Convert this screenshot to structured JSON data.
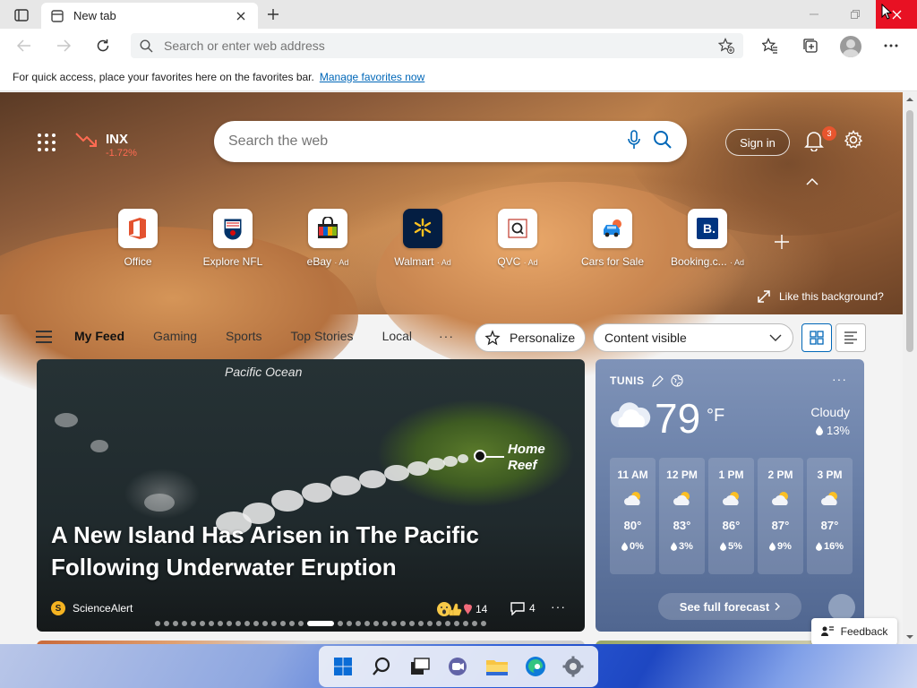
{
  "browser": {
    "tab_title": "New tab",
    "address_placeholder": "Search or enter web address",
    "favorites_message": "For quick access, place your favorites here on the favorites bar.",
    "favorites_link": "Manage favorites now"
  },
  "hero": {
    "stock_symbol": "INX",
    "stock_change": "-1.72%",
    "search_placeholder": "Search the web",
    "sign_in_label": "Sign in",
    "notification_count": "3",
    "like_background_label": "Like this background?",
    "tiles": [
      {
        "label": "Office",
        "ad": ""
      },
      {
        "label": "Explore NFL",
        "ad": ""
      },
      {
        "label": "eBay",
        "ad": "· Ad"
      },
      {
        "label": "Walmart",
        "ad": "· Ad"
      },
      {
        "label": "QVC",
        "ad": "· Ad"
      },
      {
        "label": "Cars for Sale",
        "ad": ""
      },
      {
        "label": "Booking.c...",
        "ad": "· Ad"
      }
    ]
  },
  "feed_nav": {
    "tabs": [
      "My Feed",
      "Gaming",
      "Sports",
      "Top Stories",
      "Local"
    ],
    "more": "···",
    "personalize_label": "Personalize",
    "content_select_value": "Content visible"
  },
  "main_card": {
    "map_label_ocean": "Pacific Ocean",
    "map_label_reef_1": "Home",
    "map_label_reef_2": "Reef",
    "headline": "A New Island Has Arisen in The Pacific Following Underwater Eruption",
    "source_initial": "S",
    "source_name": "ScienceAlert",
    "reaction_count": "14",
    "comment_count": "4",
    "more": "···"
  },
  "weather": {
    "city": "TUNIS",
    "temperature": "79",
    "unit": "°F",
    "condition": "Cloudy",
    "precipitation": "13%",
    "more": "···",
    "hours": [
      {
        "time": "11 AM",
        "temp": "80°",
        "precip": "0%"
      },
      {
        "time": "12 PM",
        "temp": "83°",
        "precip": "3%"
      },
      {
        "time": "1 PM",
        "temp": "86°",
        "precip": "5%"
      },
      {
        "time": "2 PM",
        "temp": "87°",
        "precip": "9%"
      },
      {
        "time": "3 PM",
        "temp": "87°",
        "precip": "16%"
      }
    ],
    "forecast_label": "See full forecast"
  },
  "feedback_label": "Feedback",
  "colors": {
    "accent": "#0067b8",
    "close_red": "#e81123",
    "stock_down": "#ff6b52",
    "badge": "#e8552e"
  }
}
